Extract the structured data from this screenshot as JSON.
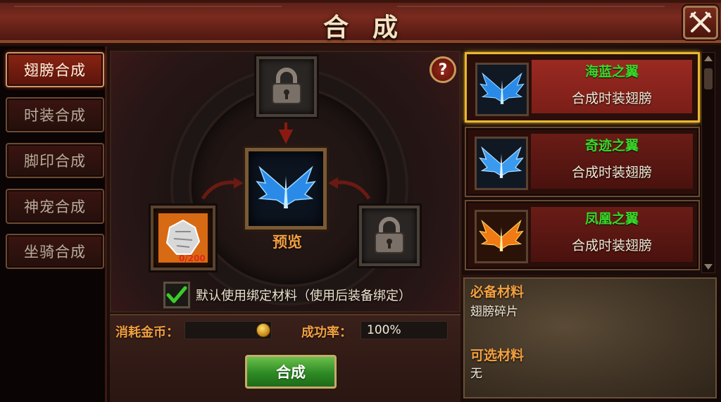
{
  "header": {
    "title": "合成",
    "close_icon": "close-crossed-swords-icon"
  },
  "tabs": [
    {
      "label": "翅膀合成",
      "active": true
    },
    {
      "label": "时装合成",
      "active": false
    },
    {
      "label": "脚印合成",
      "active": false
    },
    {
      "label": "神宠合成",
      "active": false
    },
    {
      "label": "坐骑合成",
      "active": false
    }
  ],
  "synth": {
    "help_label": "?",
    "preview_label": "预览",
    "material_count": "0/200",
    "bind_label": "默认使用绑定材料（使用后装备绑定）",
    "bind_checked": true
  },
  "cost": {
    "gold_label": "消耗金币：",
    "rate_label": "成功率：",
    "rate_value": "100%",
    "button_label": "合成"
  },
  "wing_list": [
    {
      "name": "海蓝之翼",
      "desc": "合成时装翅膀",
      "selected": true,
      "color": "#3aa8ff"
    },
    {
      "name": "奇迹之翼",
      "desc": "合成时装翅膀",
      "selected": false,
      "color": "#3aa8ff"
    },
    {
      "name": "凤凰之翼",
      "desc": "合成时装翅膀",
      "selected": false,
      "color": "#ff8a1a"
    }
  ],
  "materials": {
    "required_title": "必备材料",
    "required_value": "翅膀碎片",
    "optional_title": "可选材料",
    "optional_value": "无"
  },
  "colors": {
    "accent_orange": "#f2a040",
    "name_green": "#3ad82a",
    "select_gold": "#e8b830"
  }
}
